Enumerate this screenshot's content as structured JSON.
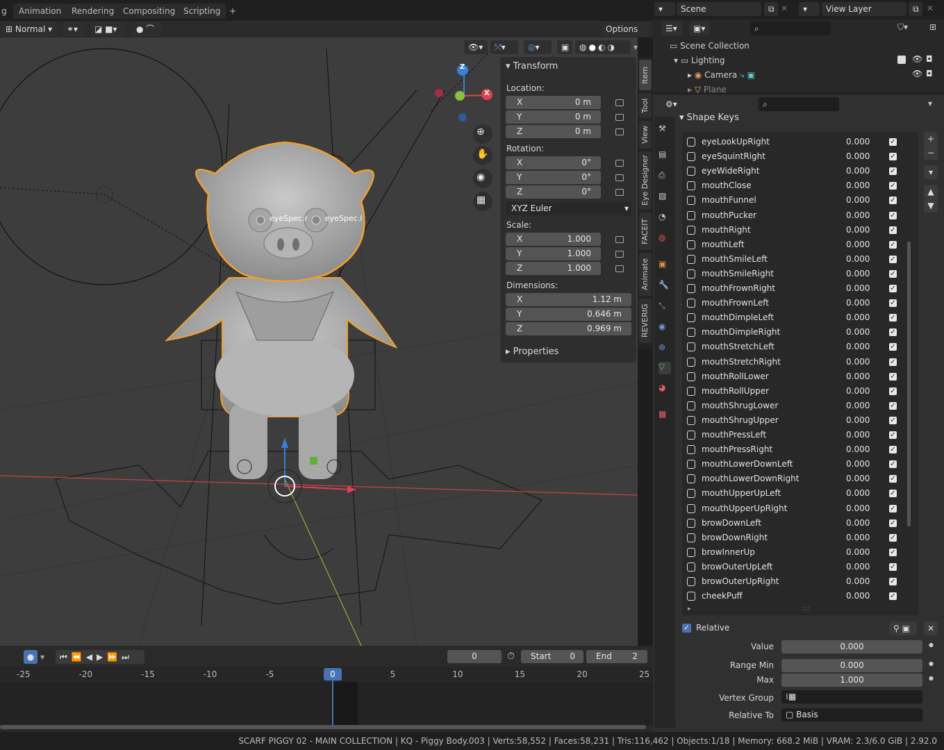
{
  "workspace_tabs": [
    "g",
    "Animation",
    "Rendering",
    "Compositing",
    "Scripting",
    "+"
  ],
  "header": {
    "scene_label": "Scene",
    "view_layer_label": "View Layer"
  },
  "viewport": {
    "mode": "Normal",
    "options_label": "Options",
    "overlay_labels": [
      "eyeSpec.r",
      "eyeSpec.l"
    ]
  },
  "npanel": {
    "title": "Transform",
    "location_label": "Location:",
    "location": [
      {
        "axis": "X",
        "value": "0 m"
      },
      {
        "axis": "Y",
        "value": "0 m"
      },
      {
        "axis": "Z",
        "value": "0 m"
      }
    ],
    "rotation_label": "Rotation:",
    "rotation": [
      {
        "axis": "X",
        "value": "0°"
      },
      {
        "axis": "Y",
        "value": "0°"
      },
      {
        "axis": "Z",
        "value": "0°"
      }
    ],
    "rotation_mode": "XYZ Euler",
    "scale_label": "Scale:",
    "scale": [
      {
        "axis": "X",
        "value": "1.000"
      },
      {
        "axis": "Y",
        "value": "1.000"
      },
      {
        "axis": "Z",
        "value": "1.000"
      }
    ],
    "dimensions_label": "Dimensions:",
    "dimensions": [
      {
        "axis": "X",
        "value": "1.12 m"
      },
      {
        "axis": "Y",
        "value": "0.646 m"
      },
      {
        "axis": "Z",
        "value": "0.969 m"
      }
    ],
    "properties_label": "Properties"
  },
  "vertical_tabs": [
    "Item",
    "Tool",
    "View",
    "Eye Designer",
    "FACEIT",
    "Animate",
    "REVERIG"
  ],
  "outliner": {
    "scene_collection": "Scene Collection",
    "items": [
      "Lighting",
      "Camera",
      "Plane"
    ]
  },
  "shape_keys": {
    "title": "Shape Keys",
    "items": [
      {
        "name": "eyeLookUpRight",
        "value": "0.000"
      },
      {
        "name": "eyeSquintRight",
        "value": "0.000"
      },
      {
        "name": "eyeWideRight",
        "value": "0.000"
      },
      {
        "name": "mouthClose",
        "value": "0.000"
      },
      {
        "name": "mouthFunnel",
        "value": "0.000"
      },
      {
        "name": "mouthPucker",
        "value": "0.000"
      },
      {
        "name": "mouthRight",
        "value": "0.000"
      },
      {
        "name": "mouthLeft",
        "value": "0.000"
      },
      {
        "name": "mouthSmileLeft",
        "value": "0.000"
      },
      {
        "name": "mouthSmileRight",
        "value": "0.000"
      },
      {
        "name": "mouthFrownRight",
        "value": "0.000"
      },
      {
        "name": "mouthFrownLeft",
        "value": "0.000"
      },
      {
        "name": "mouthDimpleLeft",
        "value": "0.000"
      },
      {
        "name": "mouthDimpleRight",
        "value": "0.000"
      },
      {
        "name": "mouthStretchLeft",
        "value": "0.000"
      },
      {
        "name": "mouthStretchRight",
        "value": "0.000"
      },
      {
        "name": "mouthRollLower",
        "value": "0.000"
      },
      {
        "name": "mouthRollUpper",
        "value": "0.000"
      },
      {
        "name": "mouthShrugLower",
        "value": "0.000"
      },
      {
        "name": "mouthShrugUpper",
        "value": "0.000"
      },
      {
        "name": "mouthPressLeft",
        "value": "0.000"
      },
      {
        "name": "mouthPressRight",
        "value": "0.000"
      },
      {
        "name": "mouthLowerDownLeft",
        "value": "0.000"
      },
      {
        "name": "mouthLowerDownRight",
        "value": "0.000"
      },
      {
        "name": "mouthUpperUpLeft",
        "value": "0.000"
      },
      {
        "name": "mouthUpperUpRight",
        "value": "0.000"
      },
      {
        "name": "browDownLeft",
        "value": "0.000"
      },
      {
        "name": "browDownRight",
        "value": "0.000"
      },
      {
        "name": "browInnerUp",
        "value": "0.000"
      },
      {
        "name": "browOuterUpLeft",
        "value": "0.000"
      },
      {
        "name": "browOuterUpRight",
        "value": "0.000"
      },
      {
        "name": "cheekPuff",
        "value": "0.000"
      }
    ],
    "relative_label": "Relative",
    "value_label": "Value",
    "value": "0.000",
    "range_min_label": "Range Min",
    "range_min": "0.000",
    "max_label": "Max",
    "max": "1.000",
    "vertex_group_label": "Vertex Group",
    "relative_to_label": "Relative To",
    "relative_to": "Basis"
  },
  "timeline": {
    "current_frame": "0",
    "start_label": "Start",
    "start": "0",
    "end_label": "End",
    "end": "2",
    "ticks": [
      "-25",
      "-20",
      "-15",
      "-10",
      "-5",
      "0",
      "5",
      "10",
      "15",
      "20",
      "25"
    ]
  },
  "status_bar": "SCARF PIGGY 02 - MAIN COLLECTION | KQ - Piggy Body.003 | Verts:58,552 | Faces:58,231 | Tris:116,462 | Objects:1/18 | Memory: 668.2 MiB | VRAM: 2.3/6.0 GiB | 2.92.0",
  "colors": {
    "accent": "#4772b3",
    "selection_orange": "#f0a030",
    "x_axis": "#e04050",
    "y_axis": "#8ac040",
    "z_axis": "#3a7fd8"
  }
}
